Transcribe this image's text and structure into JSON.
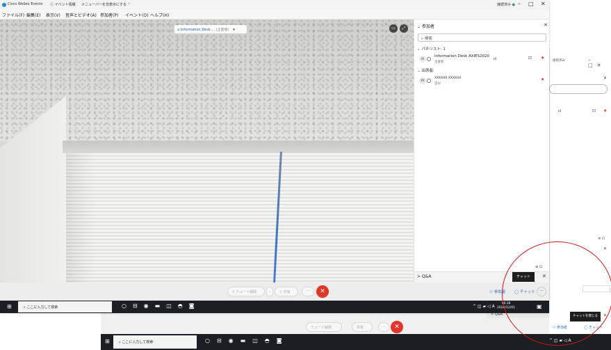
{
  "back_window": {
    "title": "接続済み",
    "closechat_tooltip": "チャットを閉じる",
    "qa_label": "> Q&A",
    "participants_label": "参加者",
    "chat_label": "チャット",
    "taskbar_search_placeholder": "ここに入力して検索"
  },
  "titlebar": {
    "app_title": "Cisco Webex Events",
    "event_info": "イベント情報",
    "menu_toggle": "メニューバーを非表示にする",
    "connection": "接続済み",
    "min": "–",
    "max": "□",
    "close": "✕"
  },
  "menubar": {
    "items": [
      "ファイル(F)",
      "編集(E)",
      "表示(V)",
      "音声とビデオ(A)",
      "参加者(P)",
      "イベント(O)",
      "ヘルプ(H)"
    ]
  },
  "video": {
    "presenter_name": "Information Desk ...",
    "presenter_role": "(主催者)"
  },
  "participants_panel": {
    "title": "参加者",
    "search_placeholder": "検索",
    "panelist_header": "パネリスト: 1",
    "attendee_header": "出席者:",
    "panelist": {
      "avatar": "IA",
      "name": "Information Desk AXIES2020",
      "role": "主催者",
      "signal": "ııl"
    },
    "attendee": {
      "avatar": "XX",
      "name": "XXXXXX XXXXXX",
      "role": "自分"
    }
  },
  "qa": {
    "label": "> Q&A",
    "chat_tooltip": "チャット"
  },
  "controls": {
    "mute": "ミュート解除",
    "share": "共有",
    "more": "···",
    "participants": "参加者",
    "chat": "チャット",
    "overflow": "···"
  },
  "taskbar": {
    "search_placeholder": "ここに入力して検索",
    "time": "16:36",
    "date": "2020/12/01",
    "ime": "A"
  },
  "colors": {
    "accent": "#2f6fd6",
    "leave": "#e1372a",
    "annotation": "#d31414",
    "taskbar": "#1b1e22"
  }
}
